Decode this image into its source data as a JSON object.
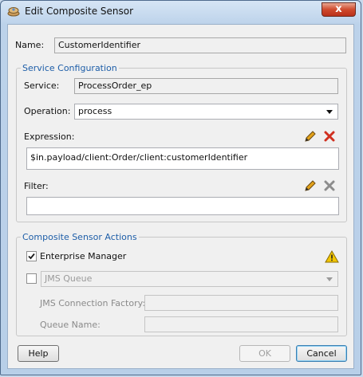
{
  "window": {
    "title": "Edit Composite Sensor",
    "close_glyph": "x"
  },
  "name_row": {
    "label": "Name:",
    "value": "CustomerIdentifier"
  },
  "service_configuration": {
    "legend": "Service Configuration",
    "service_label": "Service:",
    "service_value": "ProcessOrder_ep",
    "operation_label": "Operation:",
    "operation_value": "process",
    "expression_label": "Expression:",
    "expression_value": "$in.payload/client:Order/client:customerIdentifier",
    "filter_label": "Filter:",
    "filter_value": ""
  },
  "actions": {
    "legend": "Composite Sensor Actions",
    "enterprise_manager_label": "Enterprise Manager",
    "enterprise_manager_checked": true,
    "jms_checked": false,
    "jms_select_value": "JMS Queue",
    "jms_connection_factory_label": "JMS Connection Factory:",
    "jms_connection_factory_value": "",
    "queue_name_label": "Queue Name:",
    "queue_name_value": ""
  },
  "footer": {
    "help_label": "Help",
    "ok_label": "OK",
    "cancel_label": "Cancel"
  },
  "colors": {
    "accent": "#1e5ea8",
    "delete_red": "#d03020",
    "warning_yellow": "#f2c500"
  },
  "icons": {
    "title": "sensor-app-icon",
    "edit": "pencil-icon",
    "delete": "red-x-icon",
    "warning": "warning-triangle-icon"
  }
}
